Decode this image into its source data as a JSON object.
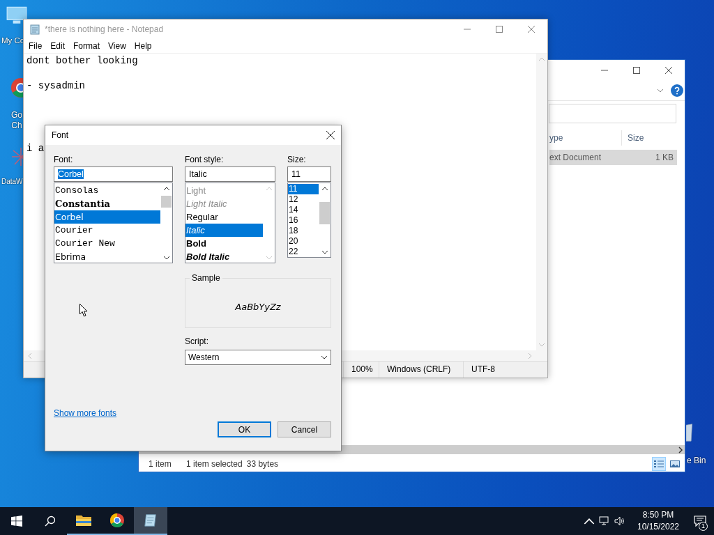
{
  "desktop_icons": [
    {
      "kind": "computer",
      "label": "My Co"
    },
    {
      "kind": "chrome",
      "label": "Go Ch"
    },
    {
      "kind": "app",
      "label": "DataW"
    },
    {
      "kind": "bin",
      "label": "e Bin"
    }
  ],
  "explorer": {
    "column_headers": [
      "ype",
      "Size"
    ],
    "rows": [
      {
        "type": "ext Document",
        "size": "1 KB",
        "selected": true
      }
    ],
    "status": [
      "1 item",
      "1 item selected",
      "33 bytes"
    ],
    "view_buttons": [
      {
        "kind": "details",
        "selected": true
      },
      {
        "kind": "tiles",
        "selected": false
      }
    ]
  },
  "notepad": {
    "title": "*there is nothing here - Notepad",
    "menu": [
      "File",
      "Edit",
      "Format",
      "View",
      "Help"
    ],
    "text": "dont bother looking\n\n- sysadmin\n\n\n\n\ni a",
    "status": [
      "100%",
      "Windows (CRLF)",
      "UTF-8"
    ]
  },
  "font_dialog": {
    "title": "Font",
    "font": {
      "label": "Font:",
      "value": "Corbel",
      "items": [
        {
          "name": "Consolas",
          "kind": "mono",
          "selected": false
        },
        {
          "name": "Constantia",
          "kind": "serif",
          "selected": false
        },
        {
          "name": "Corbel",
          "kind": "sans",
          "selected": true
        },
        {
          "name": "Courier",
          "kind": "mono",
          "selected": false
        },
        {
          "name": "Courier New",
          "kind": "mono",
          "selected": false
        },
        {
          "name": "Ebrima",
          "kind": "sans",
          "selected": false
        }
      ]
    },
    "style": {
      "label": "Font style:",
      "value": "Italic",
      "items": [
        {
          "name": "Light",
          "kind": "light",
          "selected": false
        },
        {
          "name": "Light Italic",
          "kind": "light-italic",
          "selected": false
        },
        {
          "name": "Regular",
          "kind": "regular",
          "selected": false
        },
        {
          "name": "Italic",
          "kind": "italic",
          "selected": true
        },
        {
          "name": "Bold",
          "kind": "bold",
          "selected": false
        },
        {
          "name": "Bold Italic",
          "kind": "bold-italic",
          "selected": false
        }
      ]
    },
    "size": {
      "label": "Size:",
      "value": "11",
      "items": [
        {
          "name": "11",
          "selected": true
        },
        {
          "name": "12",
          "selected": false
        },
        {
          "name": "14",
          "selected": false
        },
        {
          "name": "16",
          "selected": false
        },
        {
          "name": "18",
          "selected": false
        },
        {
          "name": "20",
          "selected": false
        },
        {
          "name": "22",
          "selected": false
        }
      ]
    },
    "sample_label": "Sample",
    "sample_text": "AaBbYyZz",
    "script_label": "Script:",
    "script_value": "Western",
    "link": "Show more fonts",
    "buttons": [
      {
        "label": "OK",
        "default": true
      },
      {
        "label": "Cancel",
        "default": false
      }
    ]
  },
  "taskbar": {
    "apps": [
      {
        "kind": "explorer",
        "open": true,
        "active": false
      },
      {
        "kind": "chrome",
        "open": true,
        "active": false
      },
      {
        "kind": "notepad",
        "open": true,
        "active": true
      }
    ],
    "time": "8:50 PM",
    "date": "10/15/2022",
    "notifications": "1"
  }
}
